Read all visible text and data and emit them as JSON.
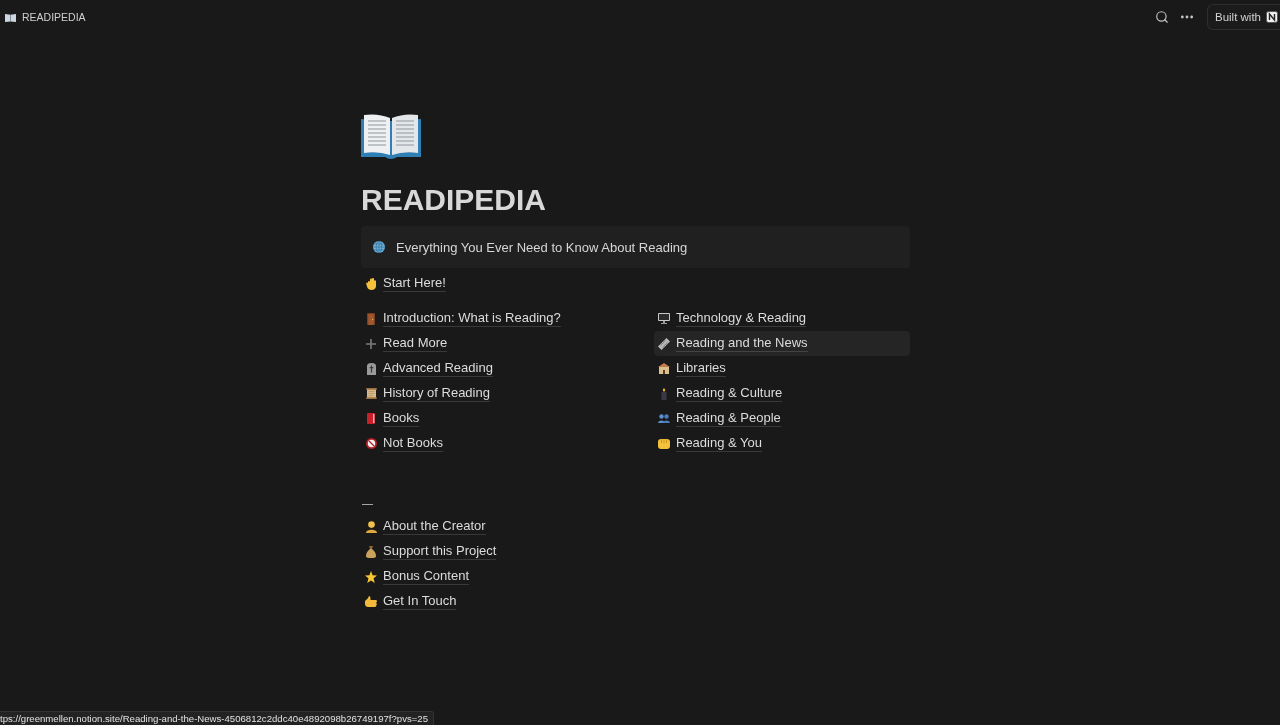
{
  "header": {
    "site_title": "READIPEDIA",
    "built_with": "Built with"
  },
  "page": {
    "title": "READIPEDIA",
    "callout": "Everything You Ever Need to Know About Reading"
  },
  "start_link": {
    "label": "Start Here!",
    "hovered": false
  },
  "left_links": [
    {
      "label": "Introduction: What is Reading?",
      "hovered": false
    },
    {
      "label": "Read More",
      "hovered": false
    },
    {
      "label": "Advanced Reading",
      "hovered": false
    },
    {
      "label": "History of Reading",
      "hovered": false
    },
    {
      "label": "Books",
      "hovered": false
    },
    {
      "label": "Not Books",
      "hovered": false
    }
  ],
  "right_links": [
    {
      "label": "Technology & Reading",
      "hovered": false
    },
    {
      "label": "Reading and the News",
      "hovered": true
    },
    {
      "label": "Libraries",
      "hovered": false
    },
    {
      "label": "Reading & Culture",
      "hovered": false
    },
    {
      "label": "Reading & People",
      "hovered": false
    },
    {
      "label": "Reading & You",
      "hovered": false
    }
  ],
  "divider": "—",
  "footer_links": [
    {
      "label": "About the Creator",
      "hovered": false
    },
    {
      "label": "Support this Project",
      "hovered": false
    },
    {
      "label": "Bonus Content",
      "hovered": false
    },
    {
      "label": "Get In Touch",
      "hovered": false
    }
  ],
  "status_url": "tps://greenmellen.notion.site/Reading-and-the-News-4506812c2ddc40e4892098b26749197f?pvs=25"
}
